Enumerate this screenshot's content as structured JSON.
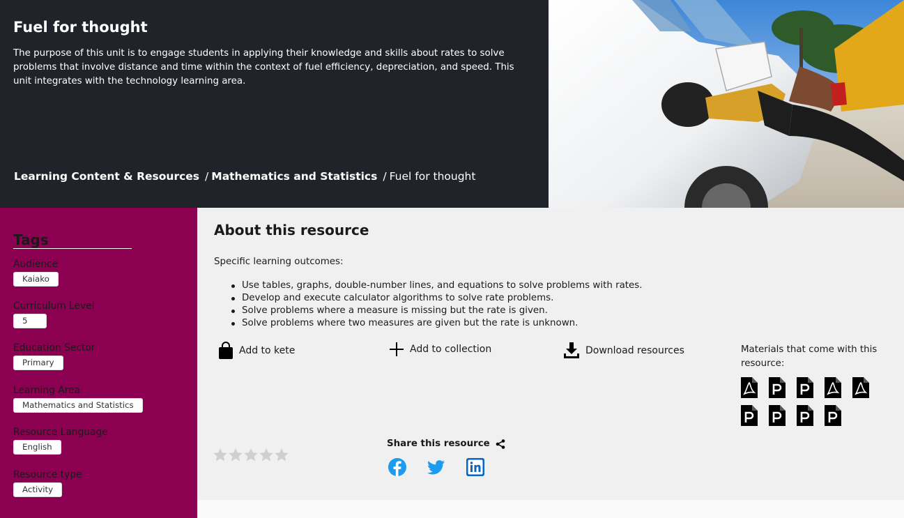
{
  "hero": {
    "title": "Fuel for thought",
    "description": "The purpose of this unit is to engage students in applying their knowledge and skills about rates to solve problems that involve distance and time within the context of fuel efficiency, depreciation, and speed. This unit integrates with the technology learning area.",
    "breadcrumb": [
      "Learning Content & Resources",
      "Mathematics and Statistics",
      "Fuel for thought"
    ],
    "breadcrumb_separator": "/"
  },
  "tags": {
    "title": "Tags",
    "groups": [
      {
        "label": "Audience",
        "value": "Kaiako"
      },
      {
        "label": "Curriculum Level",
        "value": "5"
      },
      {
        "label": "Education Sector",
        "value": "Primary"
      },
      {
        "label": "Learning Area",
        "value": "Mathematics and Statistics"
      },
      {
        "label": "Resource Language",
        "value": "English"
      },
      {
        "label": "Resource type",
        "value": "Activity"
      }
    ]
  },
  "about": {
    "title": "About this resource",
    "intro": "Specific learning outcomes:",
    "outcomes": [
      "Use tables, graphs, double-number lines, and equations to solve problems with rates.",
      "Develop and execute calculator algorithms to solve rate problems.",
      "Solve problems where a measure is missing but the rate is given.",
      "Solve problems where two measures are given but the rate is unknown."
    ]
  },
  "actions": {
    "add_kete": "Add to kete",
    "add_collection": "Add to collection",
    "download": "Download resources"
  },
  "materials": {
    "label": "Materials that come with this resource:",
    "files": [
      "pdf",
      "ppt",
      "ppt",
      "pdf",
      "pdf",
      "ppt",
      "ppt",
      "ppt",
      "ppt"
    ]
  },
  "rating": {
    "stars": 5,
    "filled": 0
  },
  "share": {
    "label": "Share this resource",
    "networks": [
      "facebook",
      "twitter",
      "linkedin"
    ]
  },
  "colors": {
    "hero_bg": "#21232b",
    "sidebar_bg": "#8c0051",
    "main_bg": "#f0f0f0",
    "social_blue": "#1d9bf0",
    "linkedin_blue": "#0a66c2"
  }
}
